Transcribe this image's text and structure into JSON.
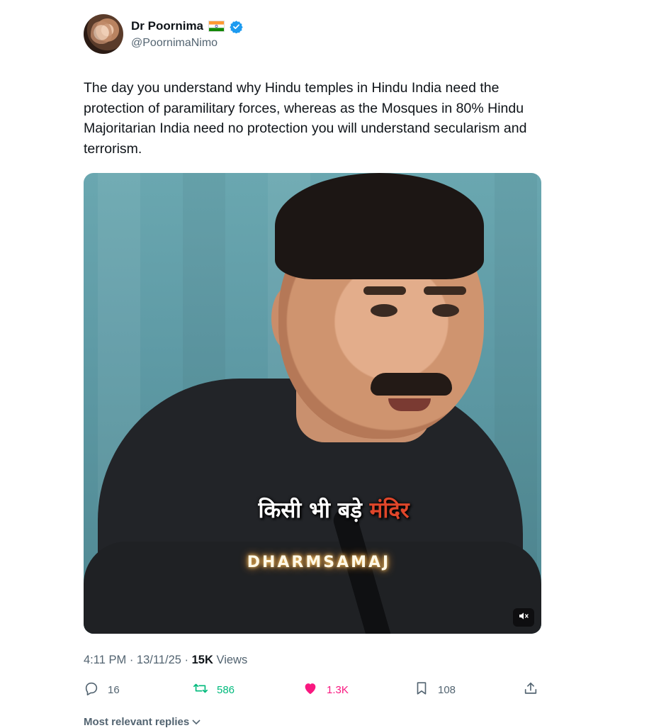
{
  "author": {
    "display_name": "Dr Poornima",
    "handle": "@PoornimaNimo",
    "flag_icon": "india-flag-icon",
    "verified_icon": "verified-badge-icon",
    "verified_color": "#1d9bf0"
  },
  "tweet": {
    "text": "The day you understand why Hindu temples in Hindu India need the protection of paramilitary forces, whereas as the Mosques in 80% Hindu Majoritarian India need no protection you will understand secularism and terrorism."
  },
  "media": {
    "caption_main": "किसी भी बड़े",
    "caption_highlight": "मंदिर",
    "watermark": "DHARMSAMAJ",
    "mute_icon": "volume-muted-icon"
  },
  "meta": {
    "time": "4:11 PM",
    "separator": "·",
    "date": "13/11/25",
    "views_count": "15K",
    "views_label": "Views"
  },
  "actions": {
    "replies": "16",
    "retweets": "586",
    "likes": "1.3K",
    "bookmarks": "108",
    "colors": {
      "retweet": "#00ba7c",
      "like": "#f91880",
      "muted": "#536471"
    }
  },
  "replies_sort": {
    "label": "Most relevant replies"
  }
}
